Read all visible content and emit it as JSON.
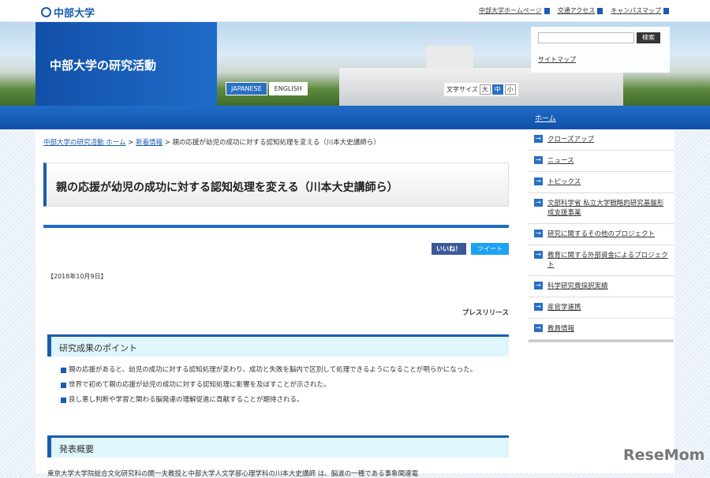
{
  "header": {
    "logo": "中部大学",
    "links": [
      "中部大学ホームページ",
      "交通アクセス",
      "キャンパスマップ"
    ]
  },
  "banner": {
    "title": "中部大学の研究活動",
    "lang": [
      "JAPANESE",
      "ENGLISH"
    ],
    "font_size_label": "文字サイズ",
    "font_sizes": [
      "大",
      "中",
      "小"
    ],
    "search_button": "検索",
    "search_value": "",
    "sitemap": "サイトマップ"
  },
  "nav": {
    "home": "ホーム"
  },
  "breadcrumb": {
    "home": "中部大学の研究活動 ホーム",
    "news": "新着情報",
    "current": "親の応援が幼児の成功に対する認知処理を変える（川本大史講師ら）",
    "sep": ">"
  },
  "article": {
    "title": "親の応援が幼児の成功に対する認知処理を変える（川本大史講師ら）",
    "like": "いいね！",
    "tweet": "ツイート",
    "date": "【2018年10月9日】",
    "press": "プレスリリース",
    "section1": "研究成果のポイント",
    "points": [
      "親の応援があると、幼児の成功に対する認知処理が変わり、成功と失敗を脳内で区別して処理できるようになることが明らかになった。",
      "世界で初めて親の応援が幼児の成功に対する認知処理に影響を及ぼすことが示された。",
      "良し悪し判断や学習と関わる脳発達の理解促進に貢献することが期待される。"
    ],
    "section2": "発表概要",
    "body_partial": "東京大学大学院総合文化研究科の開一夫教授と中部大学人文学部心理学科の川本大史講師 は、脳波の一種である事象関連電"
  },
  "sidebar": {
    "items": [
      "クローズアップ",
      "ニュース",
      "トピックス",
      "文部科学省 私立大学戦略的研究基盤形成支援事業",
      "研究に関するその他のプロジェクト",
      "教育に関する外部資金によるプロジェクト",
      "科学研究費採択実績",
      "産官学連携",
      "教員情報"
    ]
  },
  "watermark": "ReseMom"
}
